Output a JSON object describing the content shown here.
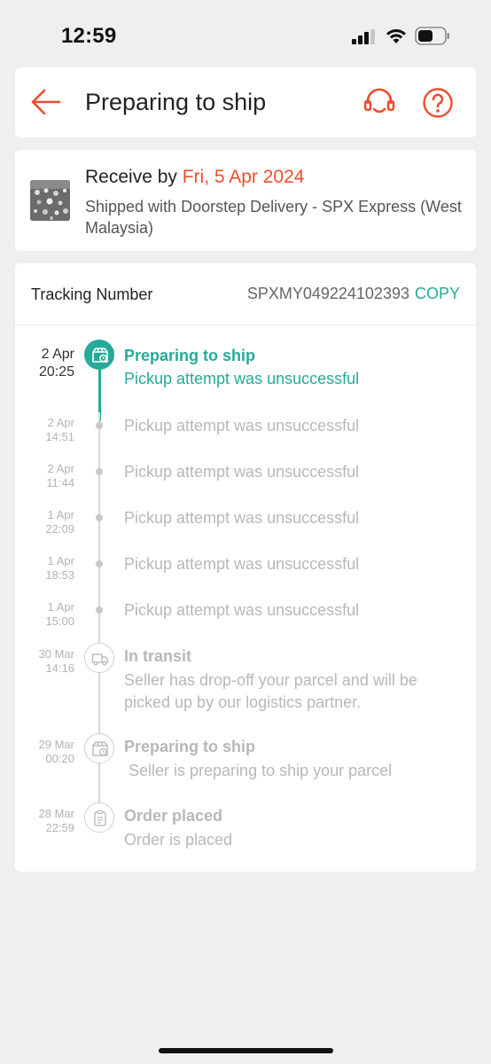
{
  "status_bar": {
    "time": "12:59"
  },
  "header": {
    "title": "Preparing to ship"
  },
  "receive": {
    "prefix": "Receive by ",
    "date": "Fri, 5 Apr 2024",
    "shipping": "Shipped with Doorstep Delivery - SPX Express (West Malaysia)"
  },
  "tracking": {
    "label": "Tracking Number",
    "number": "SPXMY049224102393",
    "copy_label": "COPY"
  },
  "events": [
    {
      "date": "2 Apr",
      "time": "20:25",
      "title": "Preparing to ship",
      "desc": "Pickup attempt was unsuccessful",
      "icon": "box-clock-icon",
      "active": true
    },
    {
      "date": "2 Apr",
      "time": "14:51",
      "title": "",
      "desc": "Pickup attempt was unsuccessful",
      "icon": "dot"
    },
    {
      "date": "2 Apr",
      "time": "11:44",
      "title": "",
      "desc": "Pickup attempt was unsuccessful",
      "icon": "dot"
    },
    {
      "date": "1 Apr",
      "time": "22:09",
      "title": "",
      "desc": "Pickup attempt was unsuccessful",
      "icon": "dot"
    },
    {
      "date": "1 Apr",
      "time": "18:53",
      "title": "",
      "desc": "Pickup attempt was unsuccessful",
      "icon": "dot"
    },
    {
      "date": "1 Apr",
      "time": "15:00",
      "title": "",
      "desc": "Pickup attempt was unsuccessful",
      "icon": "dot"
    },
    {
      "date": "30 Mar",
      "time": "14:16",
      "title": "In transit",
      "desc": "Seller has drop-off your parcel and will be picked up by our logistics partner.",
      "icon": "truck-icon"
    },
    {
      "date": "29 Mar",
      "time": "00:20",
      "title": "Preparing to ship",
      "desc": " Seller is preparing to ship your parcel",
      "icon": "box-clock-icon"
    },
    {
      "date": "28 Mar",
      "time": "22:59",
      "title": "Order placed",
      "desc": "Order is placed",
      "icon": "clipboard-icon"
    }
  ],
  "colors": {
    "accent": "#ee4d2d",
    "teal": "#26aa99",
    "muted": "#b8b8b8",
    "background": "#efefef"
  }
}
